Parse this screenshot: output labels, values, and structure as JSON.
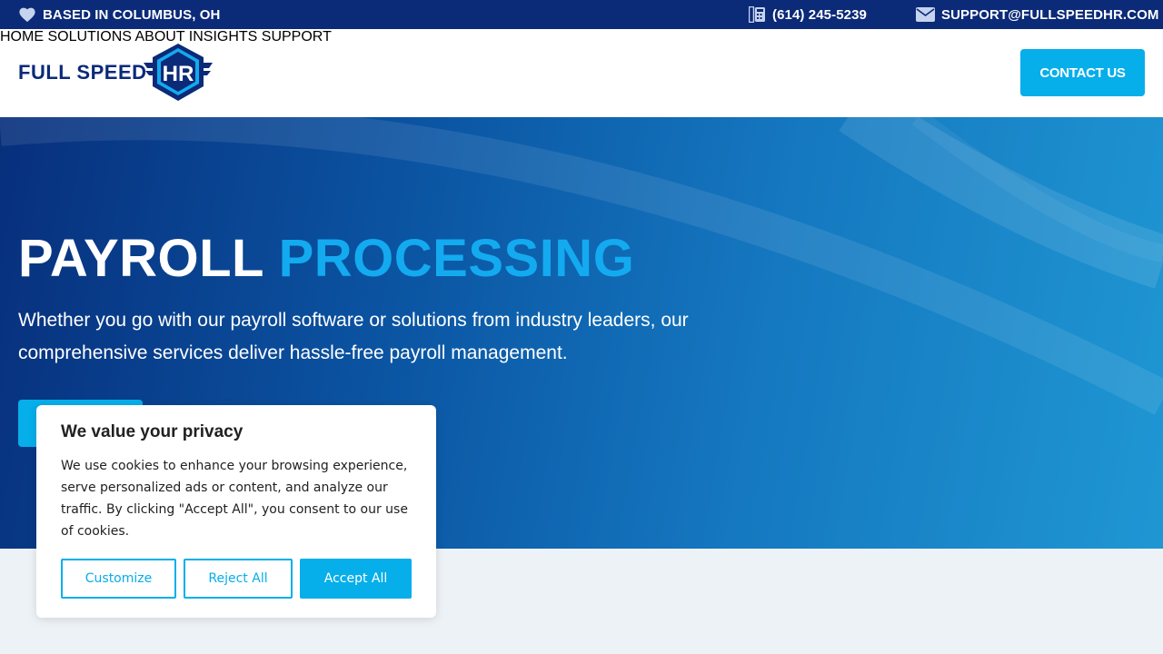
{
  "topbar": {
    "location": "BASED IN COLUMBUS, OH",
    "phone": "(614) 245-5239",
    "email": "SUPPORT@FULLSPEEDHR.COM"
  },
  "logo": {
    "text": "FULL SPEED",
    "badge": "HR"
  },
  "nav": {
    "items": [
      {
        "label": "HOME"
      },
      {
        "label": "SOLUTIONS"
      },
      {
        "label": "ABOUT"
      },
      {
        "label": "INSIGHTS"
      },
      {
        "label": "SUPPORT"
      }
    ],
    "cta": "CONTACT US"
  },
  "hero": {
    "title_main": "PAYROLL",
    "title_accent": "PROCESSING",
    "subtitle": "Whether you go with our payroll software or solutions from industry leaders, our comprehensive services deliver hassle-free payroll management."
  },
  "cookie": {
    "title": "We value your privacy",
    "body": "We use cookies to enhance your browsing experience, serve personalized ads or content, and analyze our traffic. By clicking \"Accept All\", you consent to our use of cookies.",
    "customize": "Customize",
    "reject": "Reject All",
    "accept": "Accept All"
  },
  "colors": {
    "navy": "#0b2a78",
    "accent": "#06aeea",
    "title_accent": "#13aaf0"
  },
  "icons": {
    "location": "heart-icon",
    "phone": "phone-icon",
    "email": "envelope-icon"
  }
}
